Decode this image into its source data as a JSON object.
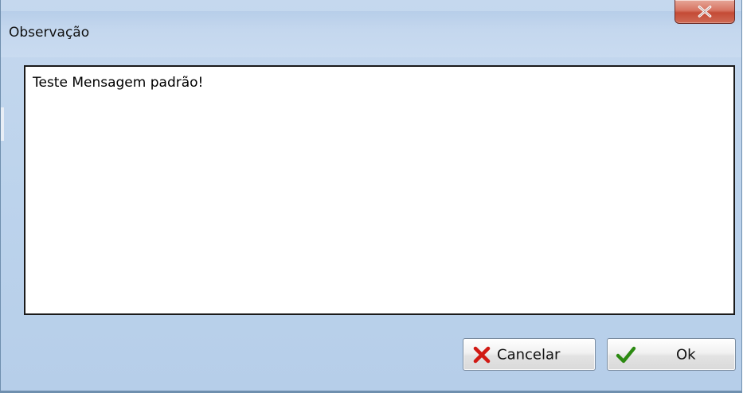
{
  "window": {
    "title": "Observação",
    "close_button_label": "X"
  },
  "message": {
    "text": "Teste Mensagem padrão!"
  },
  "buttons": {
    "cancel_label": "Cancelar",
    "ok_label": "Ok"
  },
  "icons": {
    "close": "close-icon",
    "cancel": "red-x-icon",
    "ok": "green-checkmark-icon"
  },
  "colors": {
    "title_bar": "#c4d7ee",
    "close_button": "#c44b36",
    "cancel_icon": "#d11a14",
    "ok_icon": "#2c8a12"
  }
}
